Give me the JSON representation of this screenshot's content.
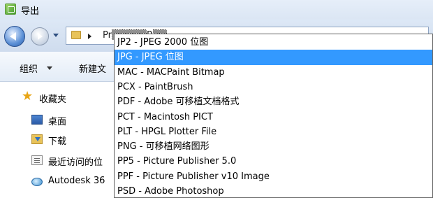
{
  "window": {
    "title": "导出"
  },
  "address": {
    "breadcrumb": "Pr▒▒▒▒▒R▒▒"
  },
  "toolbar": {
    "organize_label": "组织",
    "new_folder_label": "新建文"
  },
  "sidebar": {
    "items": [
      {
        "label": "收藏夹",
        "icon": "star-icon"
      },
      {
        "label": "桌面",
        "icon": "desktop-icon"
      },
      {
        "label": "下载",
        "icon": "download-folder-icon"
      },
      {
        "label": "最近访问的位",
        "icon": "recent-places-icon"
      },
      {
        "label": "Autodesk 36",
        "icon": "autodesk-cloud-icon"
      }
    ]
  },
  "dropdown": {
    "selected_index": 1,
    "selected_color": "#3399ff",
    "options": [
      "JP2 - JPEG 2000 位图",
      "JPG - JPEG 位图",
      "MAC - MACPaint Bitmap",
      "PCX - PaintBrush",
      "PDF - Adobe 可移植文档格式",
      "PCT - Macintosh PICT",
      "PLT - HPGL Plotter File",
      "PNG - 可移植网络图形",
      "PP5 - Picture Publisher 5.0",
      "PPF - Picture Publisher v10 Image",
      "PSD - Adobe Photoshop"
    ]
  }
}
